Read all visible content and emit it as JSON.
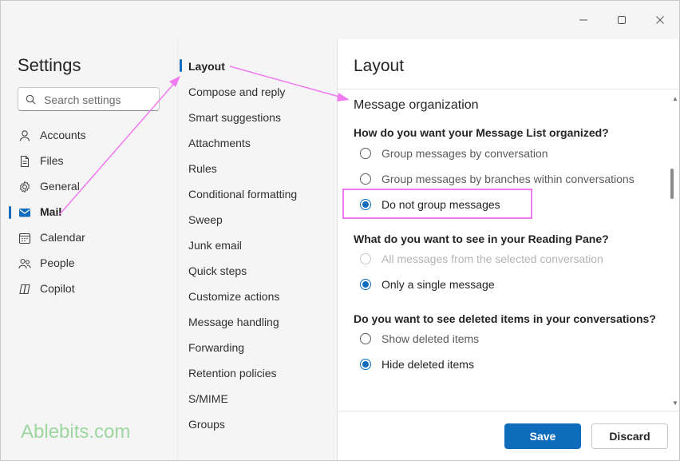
{
  "window": {
    "controls": {
      "minimize": "─",
      "maximize": "☐",
      "close": "✕"
    }
  },
  "sidebar": {
    "title": "Settings",
    "search_placeholder": "Search settings",
    "items": [
      {
        "label": "Accounts",
        "icon": "person-icon"
      },
      {
        "label": "Files",
        "icon": "file-icon"
      },
      {
        "label": "General",
        "icon": "gear-icon"
      },
      {
        "label": "Mail",
        "icon": "mail-icon",
        "active": true
      },
      {
        "label": "Calendar",
        "icon": "calendar-icon"
      },
      {
        "label": "People",
        "icon": "people-icon"
      },
      {
        "label": "Copilot",
        "icon": "copilot-icon"
      }
    ]
  },
  "submenu": {
    "items": [
      "Layout",
      "Compose and reply",
      "Smart suggestions",
      "Attachments",
      "Rules",
      "Conditional formatting",
      "Sweep",
      "Junk email",
      "Quick steps",
      "Customize actions",
      "Message handling",
      "Forwarding",
      "Retention policies",
      "S/MIME",
      "Groups"
    ],
    "active": "Layout"
  },
  "pane": {
    "title": "Layout",
    "section": "Message organization",
    "q1": {
      "question": "How do you want your Message List organized?",
      "options": [
        "Group messages by conversation",
        "Group messages by branches within conversations",
        "Do not group messages"
      ],
      "selected": "Do not group messages"
    },
    "q2": {
      "question": "What do you want to see in your Reading Pane?",
      "options": [
        "All messages from the selected conversation",
        "Only a single message"
      ],
      "selected": "Only a single message",
      "disabled": "All messages from the selected conversation"
    },
    "q3": {
      "question": "Do you want to see deleted items in your conversations?",
      "options": [
        "Show deleted items",
        "Hide deleted items"
      ],
      "selected": "Hide deleted items"
    },
    "save_label": "Save",
    "discard_label": "Discard"
  },
  "watermark": {
    "part1": "Ablebits",
    "part2": ".com"
  },
  "colors": {
    "accent": "#0f6cbd",
    "annotation": "#f07bf0",
    "watermark": "#9ed6a0"
  }
}
